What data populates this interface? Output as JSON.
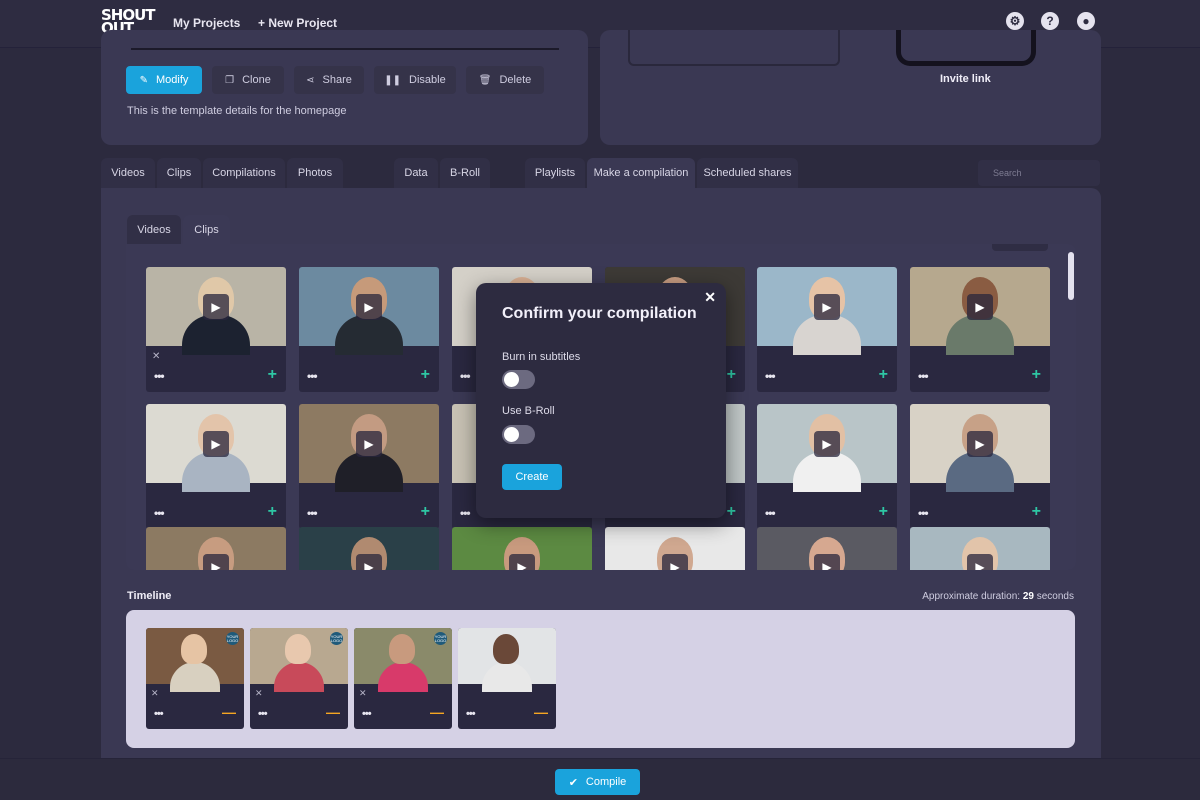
{
  "brand": {
    "logo_line1": "SHOUT",
    "logo_line2": "OUT"
  },
  "nav": {
    "my_projects": "My Projects",
    "new_project": "New Project",
    "icons": [
      "gear-icon",
      "help-icon",
      "account-icon"
    ]
  },
  "template": {
    "actions": [
      "Modify",
      "Clone",
      "Share",
      "Disable",
      "Delete"
    ],
    "description": "This is the template details for the homepage",
    "invite_link": "Invite link"
  },
  "tabs": [
    "Videos",
    "Clips",
    "Compilations",
    "Photos",
    "Data",
    "B-Roll",
    "Playlists",
    "Make a compilation",
    "Scheduled shares"
  ],
  "active_tab": "Make a compilation",
  "search": {
    "placeholder": "Search",
    "value": ""
  },
  "subtabs": [
    "Videos",
    "Clips"
  ],
  "active_subtab": "Clips",
  "clip_card": {
    "more": "•••",
    "add": "+",
    "remove": "✕"
  },
  "modal": {
    "title": "Confirm your compilation",
    "close": "✕",
    "burn_subtitles_label": "Burn in subtitles",
    "burn_subtitles": false,
    "broll_label": "Use B-Roll",
    "broll": false,
    "create_label": "Create"
  },
  "timeline": {
    "title": "Timeline",
    "duration_prefix": "Approximate duration: ",
    "duration_value": "29",
    "duration_suffix": " seconds",
    "logo_badge": "YOUR LOGO",
    "remove": "—"
  },
  "compile_label": "Compile",
  "colors": {
    "accent": "#1aa3dc",
    "add": "#2ec7a4",
    "remove": "#f5a623",
    "bg": "#2c2a3e",
    "panel": "#3a3853"
  }
}
